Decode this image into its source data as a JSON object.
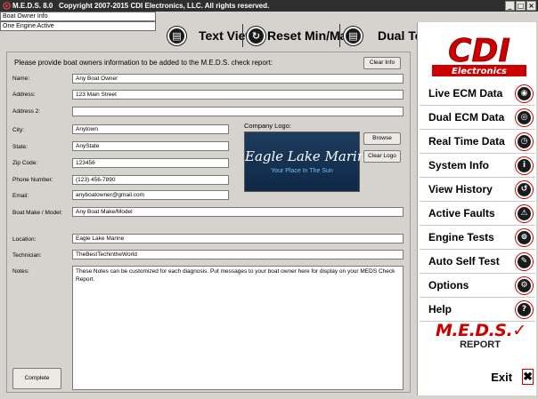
{
  "window": {
    "app_title": "M.E.D.S. 8.0",
    "copyright": "Copyright 2007-2015 CDI Electronics, LLC. All rights reserved.",
    "controls": [
      "_",
      "□",
      "×"
    ]
  },
  "status": {
    "line1": "Boat Owner Info",
    "line2": "One Engine Active"
  },
  "toolbar": {
    "text_view": "Text View",
    "reset": "Reset Min/Max",
    "dual_text": "Dual Text"
  },
  "form": {
    "intro": "Please provide boat owners information to be added to the M.E.D.S. check report:",
    "clear_info": "Clear Info",
    "fields": {
      "name": {
        "label": "Name:",
        "value": "Any Boat Owner"
      },
      "address": {
        "label": "Address:",
        "value": "123 Main Street"
      },
      "address2": {
        "label": "Address 2:",
        "value": ""
      },
      "city": {
        "label": "City:",
        "value": "Anytown"
      },
      "state": {
        "label": "State:",
        "value": "AnyState"
      },
      "zip": {
        "label": "Zip Code:",
        "value": "123456"
      },
      "phone": {
        "label": "Phone Number:",
        "value": "(123) 456-7890"
      },
      "email": {
        "label": "Email:",
        "value": "anyboatowner@gmail.com"
      },
      "boat": {
        "label": "Boat Make / Model:",
        "value": "Any Boat Make/Model"
      },
      "location": {
        "label": "Location:",
        "value": "Eagle Lake Marine"
      },
      "technician": {
        "label": "Technician:",
        "value": "TheBestTechintheWorld"
      },
      "notes": {
        "label": "Notes:",
        "value": "These Notes can be customized for each diagnosis.  Put messages to your boat owner here for display on your MEDS Check Report."
      }
    },
    "company_logo_label": "Company Logo:",
    "logo": {
      "name": "Eagle Lake Marine",
      "tagline": "Your Place In The Sun"
    },
    "browse": "Browse",
    "clear_logo": "Clear Logo",
    "complete": "Complete"
  },
  "sidebar": {
    "brand": "CDI",
    "brand_sub": "Electronics",
    "items": [
      {
        "label": "Live ECM Data",
        "icon": "broadcast-icon"
      },
      {
        "label": "Dual ECM Data",
        "icon": "dual-gauge-icon"
      },
      {
        "label": "Real Time Data",
        "icon": "clock-icon"
      },
      {
        "label": "System Info",
        "icon": "info-icon"
      },
      {
        "label": "View History",
        "icon": "history-icon"
      },
      {
        "label": "Active Faults",
        "icon": "warning-icon"
      },
      {
        "label": "Engine Tests",
        "icon": "engine-test-icon"
      },
      {
        "label": "Auto Self Test",
        "icon": "wrench-icon"
      },
      {
        "label": "Options",
        "icon": "gears-icon"
      },
      {
        "label": "Help",
        "icon": "question-icon"
      }
    ],
    "meds_report": {
      "word": "M.E.D.S.",
      "sub": "REPORT"
    },
    "exit": "Exit"
  },
  "colors": {
    "brand_red": "#cc0000",
    "panel_gray": "#d6d3ce",
    "title_bar": "#2f2f2f",
    "logo_navy": "#0f2847"
  }
}
